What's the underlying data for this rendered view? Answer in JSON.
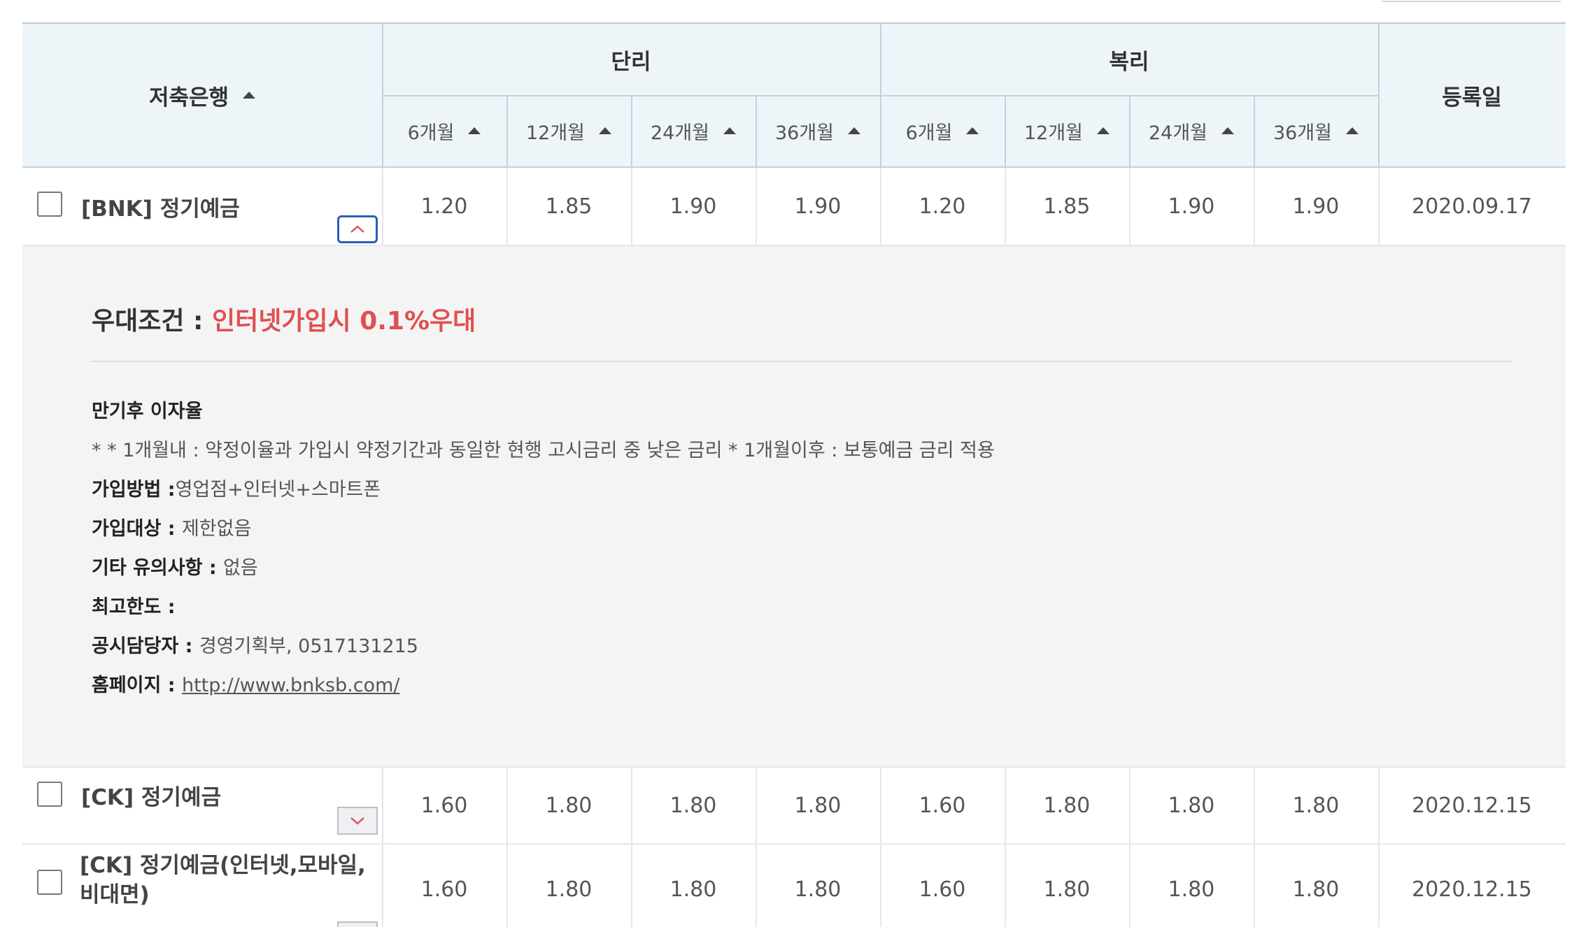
{
  "table": {
    "bank_header": "저축은행",
    "simple_header": "단리",
    "compound_header": "복리",
    "date_header": "등록일",
    "period_headers": [
      "6개월",
      "12개월",
      "24개월",
      "36개월"
    ]
  },
  "rows": [
    {
      "bank": "[BNK] 정기예금",
      "rates": [
        "1.20",
        "1.85",
        "1.90",
        "1.90",
        "1.20",
        "1.85",
        "1.90",
        "1.90"
      ],
      "date": "2020.09.17",
      "expanded": true
    },
    {
      "bank": "[CK] 정기예금",
      "rates": [
        "1.60",
        "1.80",
        "1.80",
        "1.80",
        "1.60",
        "1.80",
        "1.80",
        "1.80"
      ],
      "date": "2020.12.15",
      "expanded": false
    },
    {
      "bank_line1": "[CK] 정기예금(인터넷,모바일,",
      "bank_line2": "비대면)",
      "rates": [
        "1.60",
        "1.80",
        "1.80",
        "1.80",
        "1.60",
        "1.80",
        "1.80",
        "1.80"
      ],
      "date": "2020.12.15",
      "expanded": false
    }
  ],
  "detail": {
    "pref_label": "우대조건 : ",
    "pref_value": "인터넷가입시 0.1%우대",
    "maturity_label": "만기후 이자율",
    "maturity_text": "* * 1개월내 : 약정이율과 가입시 약정기간과 동일한 현행 고시금리 중 낮은 금리 * 1개월이후 : 보통예금 금리 적용",
    "join_method_label": "가입방법 :",
    "join_method_value": "영업점+인터넷+스마트폰",
    "join_target_label": "가입대상 : ",
    "join_target_value": "제한없음",
    "notes_label": "기타 유의사항 : ",
    "notes_value": "없음",
    "limit_label": "최고한도 : ",
    "limit_value": "",
    "contact_label": "공시담당자 : ",
    "contact_value": "경영기획부, 0517131215",
    "homepage_label": "홈페이지 : ",
    "homepage_value": "http://www.bnksb.com/"
  },
  "icons": {
    "sort": "sort-up-arrow-icon",
    "collapse": "chevron-up-icon",
    "expand": "chevron-down-icon"
  },
  "colors": {
    "header_bg": "#eef5f8",
    "accent_red": "#e05050",
    "toggle_open_border": "#2f5db5"
  }
}
